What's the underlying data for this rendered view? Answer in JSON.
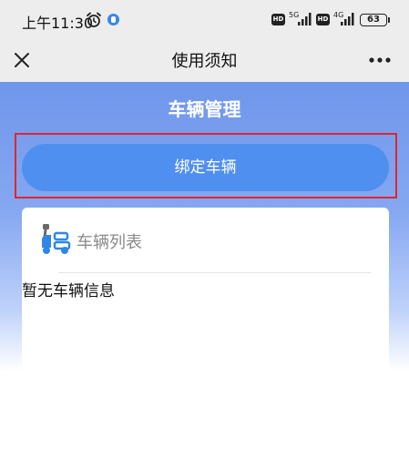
{
  "status_bar": {
    "time": "上午11:30",
    "hd_1": "HD",
    "network_1": "5G",
    "hd_2": "HD",
    "network_2": "4G",
    "battery": "63"
  },
  "nav": {
    "title": "使用须知"
  },
  "page": {
    "title": "车辆管理",
    "bind_button_label": "绑定车辆"
  },
  "vehicle_list": {
    "title": "车辆列表",
    "empty_text": "暂无车辆信息"
  },
  "colors": {
    "accent": "#4f8fef",
    "highlight_frame": "#e0262b",
    "hero_top": "#6f96ec"
  },
  "icons": {
    "close": "close-icon",
    "more": "more-icon",
    "list": "scooter-icon",
    "alarm": "alarm-icon"
  }
}
